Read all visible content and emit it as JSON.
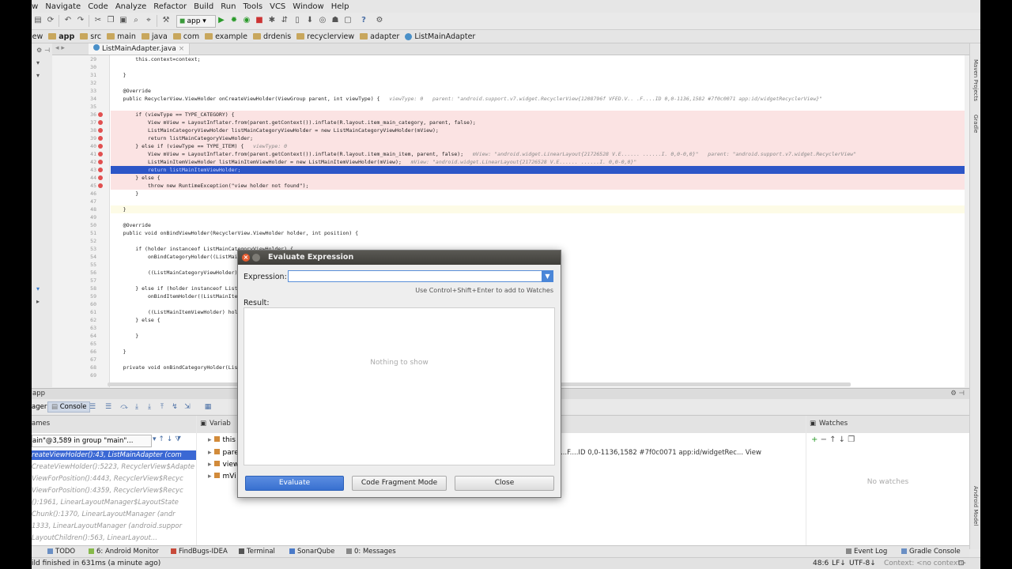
{
  "menu": [
    "ew",
    "Navigate",
    "Code",
    "Analyze",
    "Refactor",
    "Build",
    "Run",
    "Tools",
    "VCS",
    "Window",
    "Help"
  ],
  "toolbar": {
    "run_config": "app"
  },
  "breadcrumbs": [
    "iew",
    "app",
    "src",
    "main",
    "java",
    "com",
    "example",
    "drdenis",
    "recyclerview",
    "adapter",
    "ListMainAdapter"
  ],
  "editor": {
    "tab": "ListMainAdapter.java",
    "lines": [
      {
        "n": "29",
        "code": "        this.context=context;"
      },
      {
        "n": "30",
        "code": ""
      },
      {
        "n": "31",
        "code": "    }"
      },
      {
        "n": "32",
        "code": ""
      },
      {
        "n": "33",
        "code": "    @Override"
      },
      {
        "n": "34",
        "code": "    public RecyclerView.ViewHolder onCreateViewHolder(ViewGroup parent, int viewType) {",
        "inline": "   viewType: 0   parent: \"android.support.v7.widget.RecyclerView{1208796f VFED.V.. .F....ID 0,0-1136,1582 #7f0c0071 app:id/widgetRecyclerView}\""
      },
      {
        "n": "35",
        "code": ""
      },
      {
        "n": "36",
        "code": "        if (viewType == TYPE_CATEGORY) {"
      },
      {
        "n": "37",
        "code": "            View mView = LayoutInflater.from(parent.getContext()).inflate(R.layout.item_main_category, parent, false);"
      },
      {
        "n": "38",
        "code": "            ListMainCategoryViewHolder listMainCategoryViewHolder = new ListMainCategoryViewHolder(mView);"
      },
      {
        "n": "39",
        "code": "            return listMainCategoryViewHolder;"
      },
      {
        "n": "40",
        "code": "        } else if (viewType == TYPE_ITEM) {",
        "inline": "   viewType: 0"
      },
      {
        "n": "41",
        "code": "            View mView = LayoutInflater.from(parent.getContext()).inflate(R.layout.item_main_item, parent, false);",
        "inline": "   mView: \"android.widget.LinearLayout{21726528 V.E...... ......I. 0,0-0,0}\"   parent: \"android.support.v7.widget.RecyclerView\""
      },
      {
        "n": "42",
        "code": "            ListMainItemViewHolder listMainItemViewHolder = new ListMainItemViewHolder(mView);",
        "inline": "   mView: \"android.widget.LinearLayout{21726528 V.E...... ......I. 0,0-0,0}\""
      },
      {
        "n": "43",
        "code": "            return listMainItemViewHolder;"
      },
      {
        "n": "44",
        "code": "        } else {"
      },
      {
        "n": "45",
        "code": "            throw new RuntimeException(\"view holder not found\");"
      },
      {
        "n": "46",
        "code": "        }"
      },
      {
        "n": "47",
        "code": ""
      },
      {
        "n": "48",
        "code": "    }"
      },
      {
        "n": "49",
        "code": ""
      },
      {
        "n": "50",
        "code": "    @Override"
      },
      {
        "n": "51",
        "code": "    public void onBindViewHolder(RecyclerView.ViewHolder holder, int position) {"
      },
      {
        "n": "52",
        "code": ""
      },
      {
        "n": "53",
        "code": "        if (holder instanceof ListMainCategoryViewHolder) {"
      },
      {
        "n": "54",
        "code": "            onBindCategoryHolder((ListMainCategoryViewHolder) holder, position);"
      },
      {
        "n": "55",
        "code": ""
      },
      {
        "n": "56",
        "code": "            ((ListMainCategoryViewHolder) holder).setData(position);"
      },
      {
        "n": "57",
        "code": ""
      },
      {
        "n": "58",
        "code": "        } else if (holder instanceof ListMainItemViewHolder) {"
      },
      {
        "n": "59",
        "code": "            onBindItemHolder((ListMainItemViewHolder) holder, position);"
      },
      {
        "n": "60",
        "code": ""
      },
      {
        "n": "61",
        "code": "            ((ListMainItemViewHolder) holder).setData(position);"
      },
      {
        "n": "62",
        "code": "        } else {"
      },
      {
        "n": "63",
        "code": ""
      },
      {
        "n": "64",
        "code": "        }"
      },
      {
        "n": "65",
        "code": ""
      },
      {
        "n": "66",
        "code": "    }"
      },
      {
        "n": "67",
        "code": ""
      },
      {
        "n": "68",
        "code": "    private void onBindCategoryHolder(ListMainCategoryViewHolder holder, int position) {"
      },
      {
        "n": "69",
        "code": ""
      }
    ]
  },
  "side_tools": {
    "right_top": "Maven Projects",
    "right_mid": "Gradle",
    "right_bottom": "Android Model"
  },
  "debug": {
    "title": "app",
    "tabs": {
      "debugger": "ager",
      "console": "Console"
    },
    "frames_title": "ames",
    "thread": "ain\"@3,589 in group \"main\"...",
    "frames": [
      "reateViewHolder():43, ListMainAdapter (com",
      "CreateViewHolder():5223, RecyclerView$Adapte",
      "ViewForPosition():4443, RecyclerView$Recyc",
      "ViewForPosition():4359, RecyclerView$Recyc",
      "():1961, LinearLayoutManager$LayoutState",
      "Chunk():1370, LinearLayoutManager (andr",
      "1333, LinearLayoutManager (android.suppor",
      "LayoutChildren():563, LinearLayout..."
    ],
    "vars_title": "Variab",
    "vars": [
      {
        "name": "this"
      },
      {
        "name": "pare"
      },
      {
        "name": "view"
      },
      {
        "name": "mVi"
      }
    ],
    "vars_value": "...F....ID 0,0-1136,1582 #7f0c0071 app:id/widgetRec... View",
    "watches_title": "Watches",
    "no_watches": "No watches"
  },
  "bottom_tools": [
    "TODO",
    "6: Android Monitor",
    "FindBugs-IDEA",
    "Terminal",
    "SonarQube",
    "0: Messages"
  ],
  "bottom_right": [
    "Event Log",
    "Gradle Console"
  ],
  "status": {
    "message": "ild finished in 631ms (a minute ago)",
    "position": "48:6",
    "line_sep": "LF↓",
    "encoding": "UTF-8↓",
    "context": "Context: <no context>"
  },
  "dialog": {
    "title": "Evaluate Expression",
    "expression_label": "Expression:",
    "expression_value": "",
    "hint": "Use Control+Shift+Enter to add to Watches",
    "result_label": "Result:",
    "empty": "Nothing to show",
    "buttons": {
      "evaluate": "Evaluate",
      "fragment": "Code Fragment Mode",
      "close": "Close"
    }
  }
}
